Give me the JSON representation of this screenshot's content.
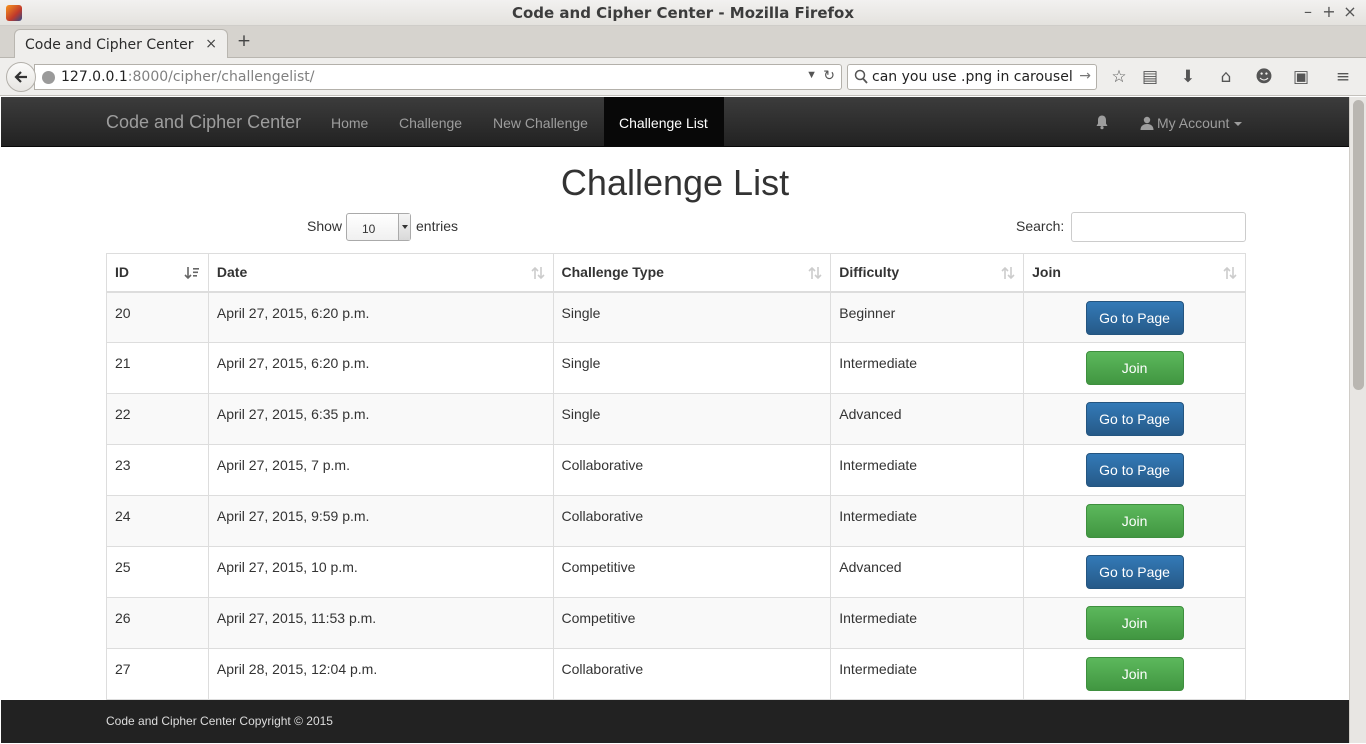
{
  "window": {
    "title": "Code and Cipher Center - Mozilla Firefox",
    "tab_label": "Code and Cipher Center",
    "url_host": "127.0.0.1",
    "url_path": ":8000/cipher/challengelist/",
    "search_query": "can you use .png in carousel"
  },
  "navbar": {
    "brand": "Code and Cipher Center",
    "links": [
      "Home",
      "Challenge",
      "New Challenge"
    ],
    "active_link": "Challenge List",
    "account_label": "My Account"
  },
  "page": {
    "title": "Challenge List",
    "show_label": "Show",
    "entries_value": "10",
    "entries_label": "entries",
    "search_label": "Search:",
    "search_value": ""
  },
  "table": {
    "columns": [
      "ID",
      "Date",
      "Challenge Type",
      "Difficulty",
      "Join"
    ],
    "rows": [
      {
        "id": "20",
        "date": "April 27, 2015, 6:20 p.m.",
        "type": "Single",
        "difficulty": "Beginner",
        "action": "Go to Page",
        "action_style": "primary"
      },
      {
        "id": "21",
        "date": "April 27, 2015, 6:20 p.m.",
        "type": "Single",
        "difficulty": "Intermediate",
        "action": "Join",
        "action_style": "success"
      },
      {
        "id": "22",
        "date": "April 27, 2015, 6:35 p.m.",
        "type": "Single",
        "difficulty": "Advanced",
        "action": "Go to Page",
        "action_style": "primary"
      },
      {
        "id": "23",
        "date": "April 27, 2015, 7 p.m.",
        "type": "Collaborative",
        "difficulty": "Intermediate",
        "action": "Go to Page",
        "action_style": "primary"
      },
      {
        "id": "24",
        "date": "April 27, 2015, 9:59 p.m.",
        "type": "Collaborative",
        "difficulty": "Intermediate",
        "action": "Join",
        "action_style": "success"
      },
      {
        "id": "25",
        "date": "April 27, 2015, 10 p.m.",
        "type": "Competitive",
        "difficulty": "Advanced",
        "action": "Go to Page",
        "action_style": "primary"
      },
      {
        "id": "26",
        "date": "April 27, 2015, 11:53 p.m.",
        "type": "Competitive",
        "difficulty": "Intermediate",
        "action": "Join",
        "action_style": "success"
      },
      {
        "id": "27",
        "date": "April 28, 2015, 12:04 p.m.",
        "type": "Collaborative",
        "difficulty": "Intermediate",
        "action": "Join",
        "action_style": "success"
      }
    ]
  },
  "footer": {
    "copyright": "Code and Cipher Center Copyright © 2015"
  },
  "colors": {
    "navbar_bg": "#222222",
    "primary_button": "#337ab7",
    "success_button": "#5cb85c",
    "footer_bg": "#222222"
  }
}
